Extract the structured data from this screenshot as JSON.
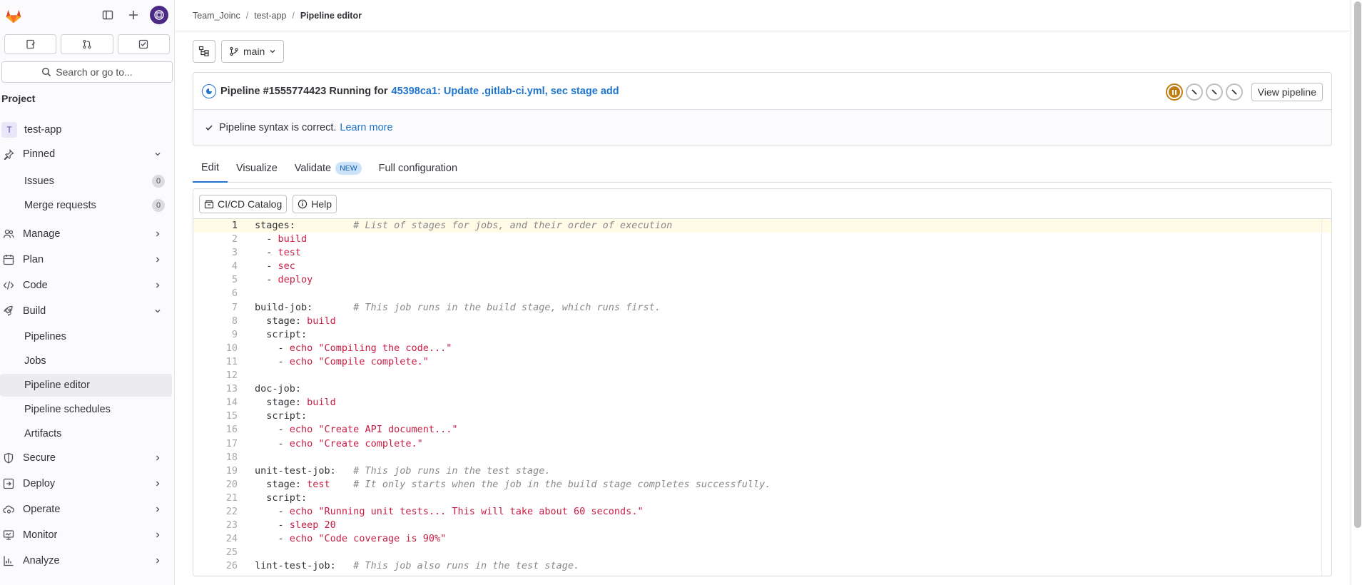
{
  "sidebar": {
    "search_label": "Search or go to...",
    "section_label": "Project",
    "project": {
      "initial": "T",
      "name": "test-app"
    },
    "pinned": {
      "label": "Pinned",
      "items": [
        {
          "label": "Issues",
          "count": "0"
        },
        {
          "label": "Merge requests",
          "count": "0"
        }
      ]
    },
    "groups": [
      {
        "label": "Manage",
        "icon": "users-icon"
      },
      {
        "label": "Plan",
        "icon": "calendar-icon"
      },
      {
        "label": "Code",
        "icon": "code-icon"
      },
      {
        "label": "Build",
        "icon": "rocket-icon"
      }
    ],
    "build_items": [
      "Pipelines",
      "Jobs",
      "Pipeline editor",
      "Pipeline schedules",
      "Artifacts"
    ],
    "groups_after": [
      {
        "label": "Secure",
        "icon": "shield-icon"
      },
      {
        "label": "Deploy",
        "icon": "deploy-icon"
      },
      {
        "label": "Operate",
        "icon": "cloud-gear-icon"
      },
      {
        "label": "Monitor",
        "icon": "monitor-icon"
      },
      {
        "label": "Analyze",
        "icon": "chart-icon"
      }
    ]
  },
  "breadcrumb": {
    "group": "Team_Joinc",
    "project": "test-app",
    "current": "Pipeline editor"
  },
  "branch": {
    "name": "main"
  },
  "pipeline": {
    "title": "Pipeline #1555774423 Running for",
    "commit_link": "45398ca1: Update .gitlab-ci.yml, sec stage add",
    "view_label": "View pipeline",
    "syntax_text": "Pipeline syntax is correct.",
    "learn_more": "Learn more"
  },
  "tabs": [
    {
      "label": "Edit"
    },
    {
      "label": "Visualize"
    },
    {
      "label": "Validate",
      "badge": "NEW"
    },
    {
      "label": "Full configuration"
    }
  ],
  "editor": {
    "catalog_label": "CI/CD Catalog",
    "help_label": "Help",
    "lines": [
      {
        "n": "1",
        "parts": [
          [
            "k",
            "stages:"
          ],
          [
            "c",
            "          # List of stages for jobs, and their order of execution"
          ]
        ]
      },
      {
        "n": "2",
        "parts": [
          [
            "k",
            "  - "
          ],
          [
            "s",
            "build"
          ]
        ]
      },
      {
        "n": "3",
        "parts": [
          [
            "k",
            "  - "
          ],
          [
            "s",
            "test"
          ]
        ]
      },
      {
        "n": "4",
        "parts": [
          [
            "k",
            "  - "
          ],
          [
            "s",
            "sec"
          ]
        ]
      },
      {
        "n": "5",
        "parts": [
          [
            "k",
            "  - "
          ],
          [
            "s",
            "deploy"
          ]
        ]
      },
      {
        "n": "6",
        "parts": []
      },
      {
        "n": "7",
        "parts": [
          [
            "k",
            "build-job:"
          ],
          [
            "c",
            "       # This job runs in the build stage, which runs first."
          ]
        ]
      },
      {
        "n": "8",
        "parts": [
          [
            "k",
            "  stage: "
          ],
          [
            "s",
            "build"
          ]
        ]
      },
      {
        "n": "9",
        "parts": [
          [
            "k",
            "  script:"
          ]
        ]
      },
      {
        "n": "10",
        "parts": [
          [
            "k",
            "    - "
          ],
          [
            "s",
            "echo \"Compiling the code...\""
          ]
        ]
      },
      {
        "n": "11",
        "parts": [
          [
            "k",
            "    - "
          ],
          [
            "s",
            "echo \"Compile complete.\""
          ]
        ]
      },
      {
        "n": "12",
        "parts": []
      },
      {
        "n": "13",
        "parts": [
          [
            "k",
            "doc-job:"
          ]
        ]
      },
      {
        "n": "14",
        "parts": [
          [
            "k",
            "  stage: "
          ],
          [
            "s",
            "build"
          ]
        ]
      },
      {
        "n": "15",
        "parts": [
          [
            "k",
            "  script:"
          ]
        ]
      },
      {
        "n": "16",
        "parts": [
          [
            "k",
            "    - "
          ],
          [
            "s",
            "echo \"Create API document...\""
          ]
        ]
      },
      {
        "n": "17",
        "parts": [
          [
            "k",
            "    - "
          ],
          [
            "s",
            "echo \"Create complete.\""
          ]
        ]
      },
      {
        "n": "18",
        "parts": []
      },
      {
        "n": "19",
        "parts": [
          [
            "k",
            "unit-test-job:"
          ],
          [
            "c",
            "   # This job runs in the test stage."
          ]
        ]
      },
      {
        "n": "20",
        "parts": [
          [
            "k",
            "  stage: "
          ],
          [
            "s",
            "test"
          ],
          [
            "c",
            "    # It only starts when the job in the build stage completes successfully."
          ]
        ]
      },
      {
        "n": "21",
        "parts": [
          [
            "k",
            "  script:"
          ]
        ]
      },
      {
        "n": "22",
        "parts": [
          [
            "k",
            "    - "
          ],
          [
            "s",
            "echo \"Running unit tests... This will take about 60 seconds.\""
          ]
        ]
      },
      {
        "n": "23",
        "parts": [
          [
            "k",
            "    - "
          ],
          [
            "s",
            "sleep 20"
          ]
        ]
      },
      {
        "n": "24",
        "parts": [
          [
            "k",
            "    - "
          ],
          [
            "s",
            "echo \"Code coverage is 90%\""
          ]
        ]
      },
      {
        "n": "25",
        "parts": []
      },
      {
        "n": "26",
        "parts": [
          [
            "k",
            "lint-test-job:"
          ],
          [
            "c",
            "   # This job also runs in the test stage."
          ]
        ]
      }
    ]
  },
  "colors": {
    "accent": "#1f75cb",
    "paused": "#c17d10",
    "string": "#c91c43",
    "comment": "#89888d"
  }
}
